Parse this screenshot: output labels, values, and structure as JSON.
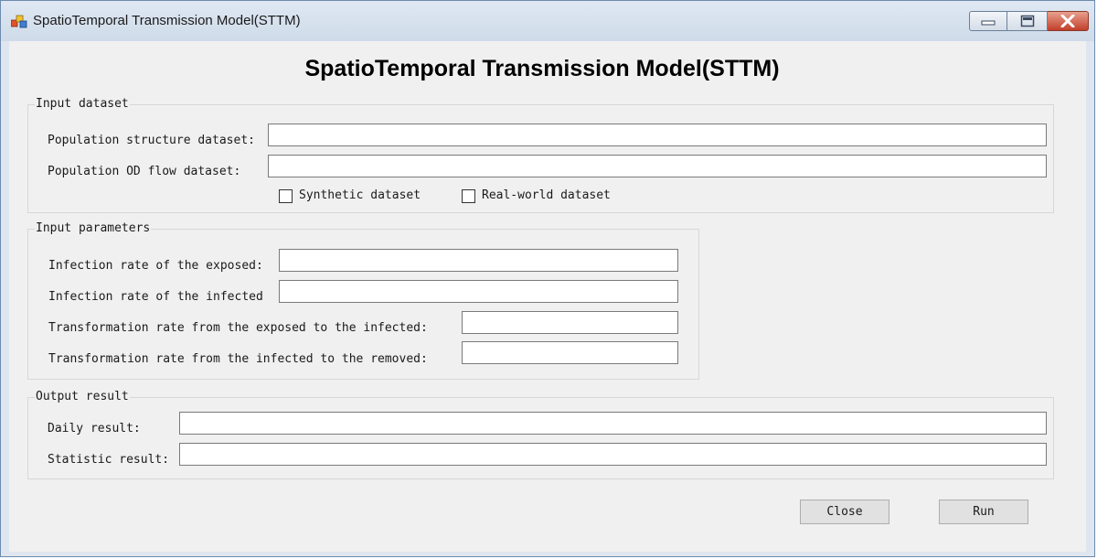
{
  "window": {
    "title": "SpatioTemporal Transmission Model(STTM)"
  },
  "heading": "SpatioTemporal Transmission Model(STTM)",
  "input_dataset": {
    "legend": "Input dataset",
    "population_structure": {
      "label": "Population structure dataset:",
      "value": ""
    },
    "population_od_flow": {
      "label": "Population OD flow dataset:",
      "value": ""
    },
    "synthetic_checkbox": {
      "label": "Synthetic dataset",
      "checked": false
    },
    "realworld_checkbox": {
      "label": "Real-world dataset",
      "checked": false
    }
  },
  "input_parameters": {
    "legend": "Input parameters",
    "infection_rate_exposed": {
      "label": "Infection rate of the exposed:",
      "value": ""
    },
    "infection_rate_infected": {
      "label": "Infection rate of the infected",
      "value": ""
    },
    "transformation_exposed_infected": {
      "label": "Transformation rate from the exposed to the infected:",
      "value": ""
    },
    "transformation_infected_removed": {
      "label": "Transformation rate from the infected to the removed:",
      "value": ""
    }
  },
  "output_result": {
    "legend": "Output result",
    "daily_result": {
      "label": "Daily result:",
      "value": ""
    },
    "statistic_result": {
      "label": "Statistic result:",
      "value": ""
    }
  },
  "buttons": {
    "close": "Close",
    "run": "Run"
  },
  "colors": {
    "client_background": "#f0f0f0",
    "close_caption": "#c1402b"
  },
  "icons": [
    "app-icon",
    "minimize-icon",
    "maximize-icon",
    "close-icon"
  ]
}
